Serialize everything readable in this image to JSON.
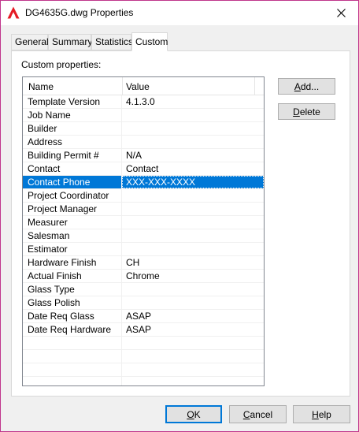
{
  "window": {
    "title": "DG4635G.dwg Properties",
    "accent": "#0078d7"
  },
  "tabs": [
    {
      "label": "General",
      "active": false
    },
    {
      "label": "Summary",
      "active": false
    },
    {
      "label": "Statistics",
      "active": false
    },
    {
      "label": "Custom",
      "active": true
    }
  ],
  "panel": {
    "label": "Custom properties:"
  },
  "grid": {
    "columns": [
      "Name",
      "Value"
    ],
    "rows": [
      {
        "name": "Template Version",
        "value": "4.1.3.0"
      },
      {
        "name": "Job Name",
        "value": ""
      },
      {
        "name": "Builder",
        "value": ""
      },
      {
        "name": "Address",
        "value": ""
      },
      {
        "name": "Building Permit #",
        "value": "N/A"
      },
      {
        "name": "Contact",
        "value": "Contact"
      },
      {
        "name": "Contact Phone",
        "value": "XXX-XXX-XXXX",
        "selected": true
      },
      {
        "name": "Project Coordinator",
        "value": ""
      },
      {
        "name": "Project Manager",
        "value": ""
      },
      {
        "name": "Measurer",
        "value": ""
      },
      {
        "name": "Salesman",
        "value": ""
      },
      {
        "name": "Estimator",
        "value": ""
      },
      {
        "name": "Hardware Finish",
        "value": "CH"
      },
      {
        "name": "Actual Finish",
        "value": "Chrome"
      },
      {
        "name": "Glass Type",
        "value": ""
      },
      {
        "name": "Glass Polish",
        "value": ""
      },
      {
        "name": "Date Req Glass",
        "value": "ASAP"
      },
      {
        "name": "Date Req Hardware",
        "value": "ASAP"
      },
      {
        "name": "",
        "value": ""
      },
      {
        "name": "",
        "value": ""
      },
      {
        "name": "",
        "value": ""
      },
      {
        "name": "",
        "value": ""
      }
    ]
  },
  "side_buttons": {
    "add": {
      "mnemonic": "A",
      "rest": "dd..."
    },
    "delete": {
      "mnemonic": "D",
      "rest": "elete"
    }
  },
  "footer_buttons": {
    "ok": {
      "mnemonic": "O",
      "rest": "K"
    },
    "cancel": {
      "mnemonic": "C",
      "rest": "ancel"
    },
    "help": {
      "mnemonic": "H",
      "rest": "elp"
    }
  },
  "icons": {
    "app": "autocad-logo-icon",
    "close": "close-icon"
  }
}
